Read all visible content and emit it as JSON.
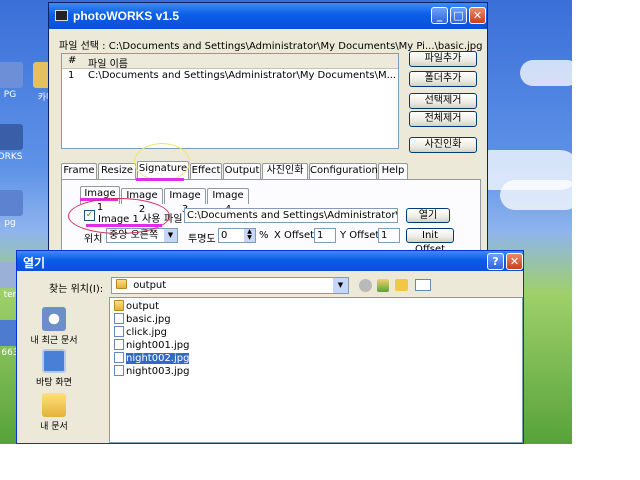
{
  "desktop": {
    "icons": [
      {
        "label": "PG"
      },
      {
        "label": "카메"
      },
      {
        "label": "ORKS"
      },
      {
        "label": "pg"
      },
      {
        "label": "ter"
      },
      {
        "label": "663"
      }
    ]
  },
  "main_window": {
    "title": "photoWORKS v1.5",
    "file_selection_label": "파일 선택 : C:\\Documents and Settings\\Administrator\\My Documents\\My Pi...\\basic.jpg",
    "list_headers": [
      "#",
      "파일 이름"
    ],
    "list_rows": [
      {
        "num": "1",
        "name": "C:\\Documents and Settings\\Administrator\\My Documents\\M..."
      }
    ],
    "side_buttons": [
      "파일추가",
      "폴더추가",
      "선택제거",
      "전체제거",
      "사진인화"
    ],
    "tabs": [
      "Frame",
      "Resize",
      "Signature",
      "Effect",
      "Output",
      "사진인화",
      "Configuration",
      "Help"
    ],
    "active_tab": "Signature",
    "image_tabs": [
      "Image 1",
      "Image 2",
      "Image 3",
      "Image 4"
    ],
    "use_image_label": "Image 1 사용",
    "file_label": "파일",
    "file_path": "C:\\Documents and Settings\\Administrator\\바",
    "open_button": "열기",
    "position_label": "위치",
    "position_value": "중앙 오른쪽",
    "transparency_label": "투명도",
    "transparency_value": "0",
    "percent": "%",
    "x_offset_label": "X Offset",
    "x_offset_value": "1",
    "y_offset_label": "Y Offset",
    "y_offset_value": "1",
    "init_offset_button": "Init Offset"
  },
  "open_dialog": {
    "title": "열기",
    "help": "?",
    "close": "✕",
    "look_in_label": "찾는 위치(I):",
    "look_in_value": "output",
    "places": [
      "내 최근 문서",
      "바탕 화면",
      "내 문서"
    ],
    "items": [
      {
        "name": "output",
        "type": "folder",
        "selected": false
      },
      {
        "name": "basic.jpg",
        "type": "file",
        "selected": false
      },
      {
        "name": "click.jpg",
        "type": "file",
        "selected": false
      },
      {
        "name": "night001.jpg",
        "type": "file",
        "selected": false
      },
      {
        "name": "night002.jpg",
        "type": "file",
        "selected": true
      },
      {
        "name": "night003.jpg",
        "type": "file",
        "selected": false
      }
    ]
  },
  "colors": {
    "highlight_ellipse": "#d0305a",
    "underline_magenta": "#e02ee8",
    "signature_circle": "#f2e36a",
    "selection": "#316ac5"
  }
}
